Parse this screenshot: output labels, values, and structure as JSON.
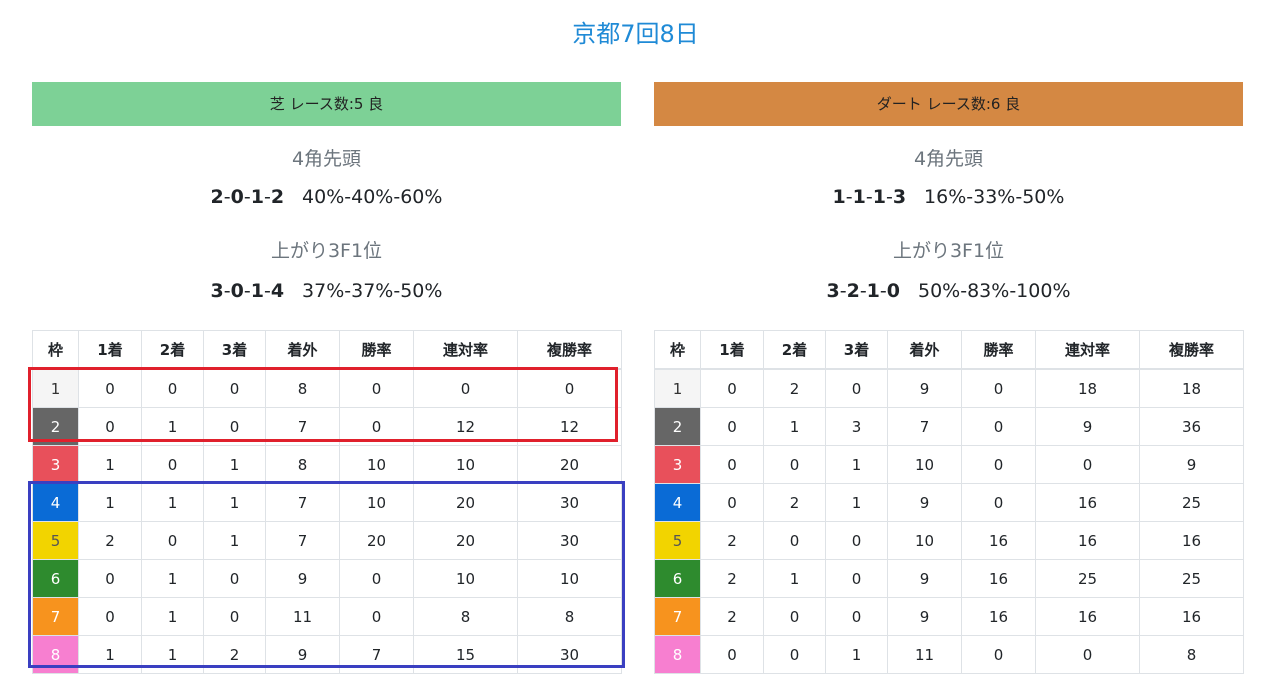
{
  "title": "京都7回8日",
  "colors": {
    "turf": "#7dd196",
    "dirt": "#d48843",
    "waku": [
      "#f5f5f5",
      "#666666",
      "#e8505b",
      "#0a6bd6",
      "#f2d400",
      "#2e8b2e",
      "#f7931e",
      "#f77fd0"
    ],
    "waku_text": [
      "#333333",
      "#ffffff",
      "#ffffff",
      "#ffffff",
      "#555555",
      "#ffffff",
      "#ffffff",
      "#ffffff"
    ],
    "highlight_red": "#e0202c",
    "highlight_blue": "#3a3fc1"
  },
  "headers": [
    "枠",
    "1着",
    "2着",
    "3着",
    "着外",
    "勝率",
    "連対率",
    "複勝率"
  ],
  "turf": {
    "bar_label": "芝 レース数:5 良",
    "corner_label": "4角先頭",
    "corner_record": [
      "2",
      "0",
      "1",
      "2"
    ],
    "corner_rates": "40%-40%-60%",
    "last3f_label": "上がり3F1位",
    "last3f_record": [
      "3",
      "0",
      "1",
      "4"
    ],
    "last3f_rates": "37%-37%-50%",
    "rows": [
      [
        "1",
        "0",
        "0",
        "0",
        "8",
        "0",
        "0",
        "0"
      ],
      [
        "2",
        "0",
        "1",
        "0",
        "7",
        "0",
        "12",
        "12"
      ],
      [
        "3",
        "1",
        "0",
        "1",
        "8",
        "10",
        "10",
        "20"
      ],
      [
        "4",
        "1",
        "1",
        "1",
        "7",
        "10",
        "20",
        "30"
      ],
      [
        "5",
        "2",
        "0",
        "1",
        "7",
        "20",
        "20",
        "30"
      ],
      [
        "6",
        "0",
        "1",
        "0",
        "9",
        "0",
        "10",
        "10"
      ],
      [
        "7",
        "0",
        "1",
        "0",
        "11",
        "0",
        "8",
        "8"
      ],
      [
        "8",
        "1",
        "1",
        "2",
        "9",
        "7",
        "15",
        "30"
      ]
    ]
  },
  "dirt": {
    "bar_label": "ダート レース数:6 良",
    "corner_label": "4角先頭",
    "corner_record": [
      "1",
      "1",
      "1",
      "3"
    ],
    "corner_rates": "16%-33%-50%",
    "last3f_label": "上がり3F1位",
    "last3f_record": [
      "3",
      "2",
      "1",
      "0"
    ],
    "last3f_rates": "50%-83%-100%",
    "rows": [
      [
        "1",
        "0",
        "2",
        "0",
        "9",
        "0",
        "18",
        "18"
      ],
      [
        "2",
        "0",
        "1",
        "3",
        "7",
        "0",
        "9",
        "36"
      ],
      [
        "3",
        "0",
        "0",
        "1",
        "10",
        "0",
        "0",
        "9"
      ],
      [
        "4",
        "0",
        "2",
        "1",
        "9",
        "0",
        "16",
        "25"
      ],
      [
        "5",
        "2",
        "0",
        "0",
        "10",
        "16",
        "16",
        "16"
      ],
      [
        "6",
        "2",
        "1",
        "0",
        "9",
        "16",
        "25",
        "25"
      ],
      [
        "7",
        "2",
        "0",
        "0",
        "9",
        "16",
        "16",
        "16"
      ],
      [
        "8",
        "0",
        "0",
        "1",
        "11",
        "0",
        "0",
        "8"
      ]
    ]
  }
}
